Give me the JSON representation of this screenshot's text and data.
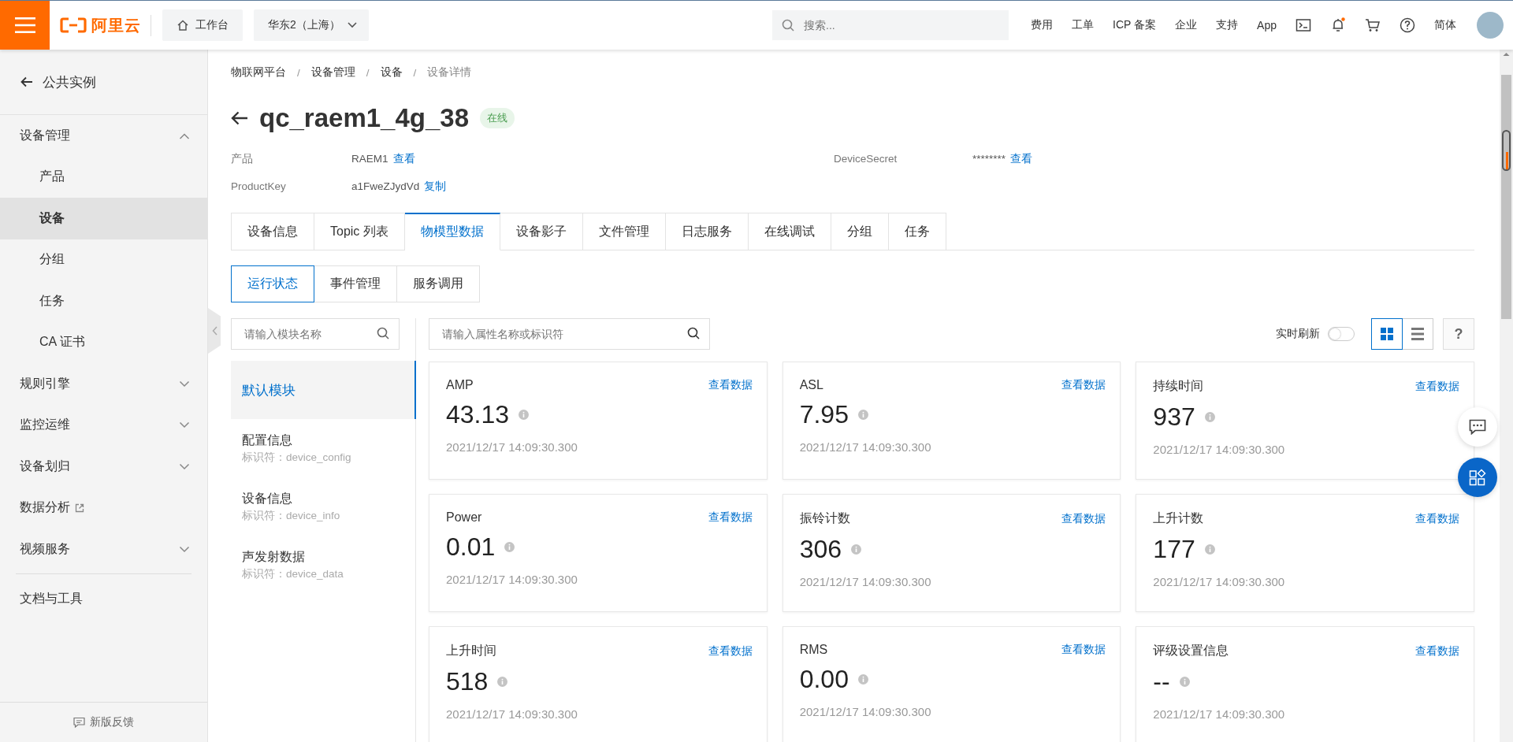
{
  "topbar": {
    "logo": "阿里云",
    "workbench": "工作台",
    "region": "华东2（上海）",
    "search": {
      "placeholder": "搜索..."
    },
    "links": [
      "费用",
      "工单",
      "ICP 备案",
      "企业",
      "支持",
      "App"
    ],
    "language": "简体"
  },
  "sidebar": {
    "back": "公共实例",
    "items": [
      {
        "label": "设备管理",
        "kind": "group",
        "expanded": true,
        "children": [
          {
            "label": "产品",
            "selected": false
          },
          {
            "label": "设备",
            "selected": true
          },
          {
            "label": "分组",
            "selected": false
          },
          {
            "label": "任务",
            "selected": false
          },
          {
            "label": "CA 证书",
            "selected": false
          }
        ]
      },
      {
        "label": "规则引擎",
        "kind": "group",
        "expanded": false
      },
      {
        "label": "监控运维",
        "kind": "group",
        "expanded": false
      },
      {
        "label": "设备划归",
        "kind": "group",
        "expanded": false
      },
      {
        "label": "数据分析",
        "kind": "external"
      },
      {
        "label": "视频服务",
        "kind": "group",
        "expanded": false
      },
      {
        "label": "文档与工具",
        "kind": "divider-link"
      }
    ],
    "feedback": "新版反馈"
  },
  "breadcrumb": [
    "物联网平台",
    "设备管理",
    "设备",
    "设备详情"
  ],
  "breadcrumb_separator": "/",
  "device": {
    "name": "qc_raem1_4g_38",
    "status": "在线",
    "fields": [
      {
        "label": "产品",
        "value": "RAEM1",
        "action": "查看"
      },
      {
        "label": "DeviceSecret",
        "value": "********",
        "action": "查看"
      },
      {
        "label": "ProductKey",
        "value": "a1FweZJydVd",
        "action": "复制"
      }
    ]
  },
  "tabs": [
    {
      "label": "设备信息",
      "selected": false
    },
    {
      "label": "Topic 列表",
      "selected": false
    },
    {
      "label": "物模型数据",
      "selected": true
    },
    {
      "label": "设备影子",
      "selected": false
    },
    {
      "label": "文件管理",
      "selected": false
    },
    {
      "label": "日志服务",
      "selected": false
    },
    {
      "label": "在线调试",
      "selected": false
    },
    {
      "label": "分组",
      "selected": false
    },
    {
      "label": "任务",
      "selected": false
    }
  ],
  "subtabs": [
    {
      "label": "运行状态",
      "selected": true
    },
    {
      "label": "事件管理",
      "selected": false
    },
    {
      "label": "服务调用",
      "selected": false
    }
  ],
  "module_search": {
    "placeholder": "请输入模块名称"
  },
  "modules": [
    {
      "name": "默认模块",
      "selected": true
    },
    {
      "name": "配置信息",
      "identifier": "标识符：device_config",
      "selected": false
    },
    {
      "name": "设备信息",
      "identifier": "标识符：device_info",
      "selected": false
    },
    {
      "name": "声发射数据",
      "identifier": "标识符：device_data",
      "selected": false
    }
  ],
  "property_search": {
    "placeholder": "请输入属性名称或标识符"
  },
  "realtime_refresh": {
    "label": "实时刷新",
    "on": false
  },
  "view_modes": [
    {
      "kind": "grid",
      "selected": true
    },
    {
      "kind": "list",
      "selected": false
    }
  ],
  "help": "?",
  "cards": [
    {
      "name": "AMP",
      "value": "43.13",
      "time": "2021/12/17 14:09:30.300",
      "link": "查看数据"
    },
    {
      "name": "ASL",
      "value": "7.95",
      "time": "2021/12/17 14:09:30.300",
      "link": "查看数据"
    },
    {
      "name": "持续时间",
      "value": "937",
      "time": "2021/12/17 14:09:30.300",
      "link": "查看数据"
    },
    {
      "name": "Power",
      "value": "0.01",
      "time": "2021/12/17 14:09:30.300",
      "link": "查看数据"
    },
    {
      "name": "振铃计数",
      "value": "306",
      "time": "2021/12/17 14:09:30.300",
      "link": "查看数据"
    },
    {
      "name": "上升计数",
      "value": "177",
      "time": "2021/12/17 14:09:30.300",
      "link": "查看数据"
    },
    {
      "name": "上升时间",
      "value": "518",
      "time": "2021/12/17 14:09:30.300",
      "link": "查看数据"
    },
    {
      "name": "RMS",
      "value": "0.00",
      "time": "2021/12/17 14:09:30.300",
      "link": "查看数据"
    },
    {
      "name": "评级设置信息",
      "value": "--",
      "time": "2021/12/17 14:09:30.300",
      "link": "查看数据"
    }
  ]
}
